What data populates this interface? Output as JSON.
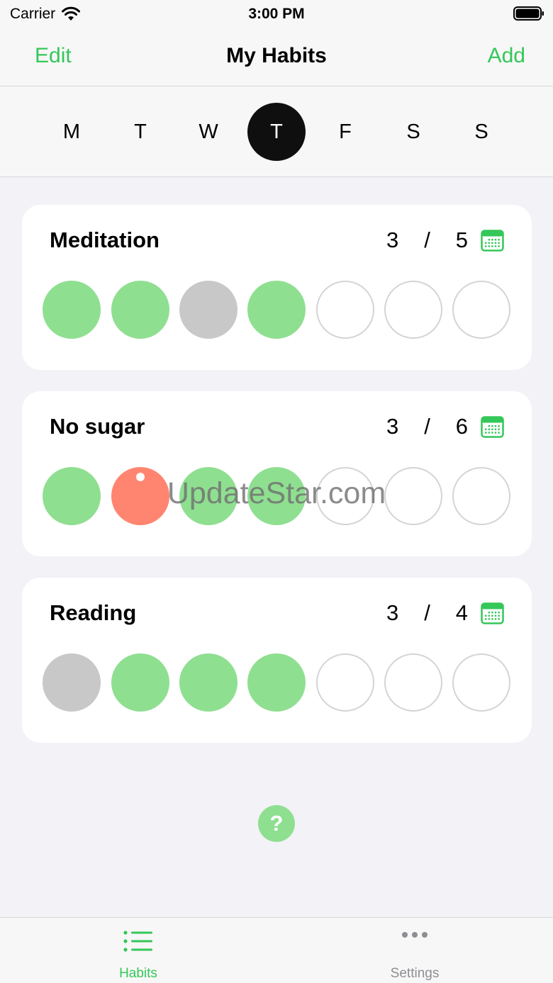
{
  "status": {
    "carrier": "Carrier",
    "time": "3:00 PM"
  },
  "nav": {
    "edit": "Edit",
    "title": "My Habits",
    "add": "Add"
  },
  "week": {
    "days": [
      "M",
      "T",
      "W",
      "T",
      "F",
      "S",
      "S"
    ],
    "selected_index": 3
  },
  "habits": [
    {
      "name": "Meditation",
      "done": "3",
      "sep": "/",
      "goal": "5",
      "days": [
        "done",
        "done",
        "skipped",
        "done",
        "empty",
        "empty",
        "empty"
      ]
    },
    {
      "name": "No sugar",
      "done": "3",
      "sep": "/",
      "goal": "6",
      "days": [
        "done",
        "failed",
        "done",
        "done",
        "empty",
        "empty",
        "empty"
      ]
    },
    {
      "name": "Reading",
      "done": "3",
      "sep": "/",
      "goal": "4",
      "days": [
        "skipped",
        "done",
        "done",
        "done",
        "empty",
        "empty",
        "empty"
      ]
    }
  ],
  "watermark": "UpdateStar.com",
  "help": "?",
  "tabs": [
    {
      "label": "Habits",
      "icon": "list-icon",
      "active": true
    },
    {
      "label": "Settings",
      "icon": "more-icon",
      "active": false
    }
  ],
  "colors": {
    "accent": "#34c759",
    "done": "#8fdf91",
    "skipped": "#c8c8c8",
    "failed": "#ff8570",
    "selected_day": "#0f0f0f"
  }
}
